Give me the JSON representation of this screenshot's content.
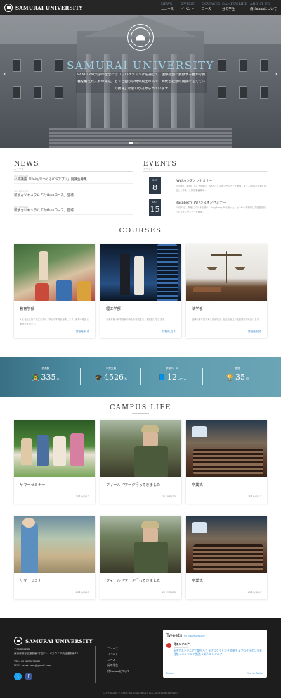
{
  "nav": {
    "logo": "SAMURAI UNIVERSITY",
    "items": [
      {
        "en": "NEWS",
        "ja": "ニュース"
      },
      {
        "en": "EVENT",
        "ja": "イベント"
      },
      {
        "en": "COURSES",
        "ja": "コース"
      },
      {
        "en": "CAMPUSLIFE",
        "ja": "分の学生"
      },
      {
        "en": "ABOUT US",
        "ja": "侍Unimaについて"
      }
    ]
  },
  "hero": {
    "title": "SAMURAI UNIVERSITY",
    "text": "SAMURAI大学の理念には「プログラミングを通じて、国際社会に貢献する豊かな教養を備えた人材の育成」と「自由な学問の風土の下で、時代と社会の要請に応えていく教育」の思いが込められています"
  },
  "news": {
    "heading": "NEWS",
    "sub": "ニュース",
    "items": [
      {
        "date": "2019/03/25",
        "title": "公開講座「UnityでつくるiOSアプリ」受講生募集"
      },
      {
        "date": "2019/03/25",
        "title": "新規カリキュラム「Pythonコース」登場!"
      },
      {
        "date": "2019/03/25",
        "title": "新規カリキュラム「Pythonコース」登場!"
      }
    ]
  },
  "events": {
    "heading": "EVENTS",
    "sub": "イベント",
    "items": [
      {
        "month": "OCT",
        "day": "8",
        "title": "AWSハンズオンセミナー",
        "body": "10月8日、新宿にて以下を使い、AWSハンズオンセミナーを開催します。AWSを実際に環境してみます。参加者募集中…"
      },
      {
        "month": "OCT",
        "day": "15",
        "title": "Raspberry Piハンズオンセミナー",
        "body": "10月15日、新宿にて以下を使い、Raspberry Piを使った、センサーを利用した自動走行ハンズオンセミナーを開催…"
      }
    ]
  },
  "courses": {
    "heading": "COURSES",
    "items": [
      {
        "title": "教育学部",
        "body": "人と社会に対する生き方や、学びの本質を追求します。教育の理論と実践を学びます。",
        "link": "詳細を見る"
      },
      {
        "title": "理工学部",
        "body": "未来を拓く科学技術の新たな可能性を、実践的に学びます。",
        "link": "詳細を見る"
      },
      {
        "title": "法学部",
        "body": "法律の基本的な考え方を学び、社会で役立つ法的思考力を養います。",
        "link": "詳細を見る"
      }
    ]
  },
  "stats": [
    {
      "label": "教員数",
      "icon": "teacher-icon",
      "glyph": "👨‍🏫",
      "value": "335",
      "unit": "名"
    },
    {
      "label": "卒業生数",
      "icon": "graduate-icon",
      "glyph": "🎓",
      "value": "4526",
      "unit": "名"
    },
    {
      "label": "学部コース",
      "icon": "book-icon",
      "glyph": "📘",
      "value": "12",
      "unit": "コース"
    },
    {
      "label": "受賞",
      "icon": "trophy-icon",
      "glyph": "🏆",
      "value": "35",
      "unit": "回"
    }
  ],
  "campus": {
    "heading": "CAMPUS LIFE",
    "items": [
      {
        "title": "サマーセミナー",
        "date": "2019/4/23"
      },
      {
        "title": "フィールドワーク行ってきました",
        "date": "2019/4/23"
      },
      {
        "title": "卒業式",
        "date": "2019/4/23"
      },
      {
        "title": "サマーセミナー",
        "date": "2019/4/23"
      },
      {
        "title": "フィールドワーク行ってきました",
        "date": "2019/4/23"
      },
      {
        "title": "卒業式",
        "date": "2019/4/23"
      }
    ]
  },
  "footer": {
    "logo": "SAMURAI UNIVERSITY",
    "zip": "〒XXX-XXXX",
    "address": "東京都渋谷区道玄坂2丁目11-1 Gスクエア渋谷道玄坂4F",
    "tel": "TEL: 03-XXXX-XXXX",
    "mail": "MAIL: xxxx.xxxx@gmail.com",
    "links": [
      "ニュース",
      "イベント",
      "コース",
      "分の学生",
      "侍Unimaについて"
    ],
    "copyright": "COPYRIGHT © SAMURAI UNIVERSITY ALL RIGHTS RESERVED."
  },
  "twitter": {
    "title": "Tweets",
    "handle": "by @samuraiuniv",
    "name": "侍エンジニア",
    "sub": "@samuraiuniv",
    "body": "#侍でエンジニアと繋がろう #プログラミング勉強中 #プログラミング未経験 #エンジニア勉強 #新人エンジニア",
    "embed": "Embed",
    "view": "View on Twitter"
  }
}
